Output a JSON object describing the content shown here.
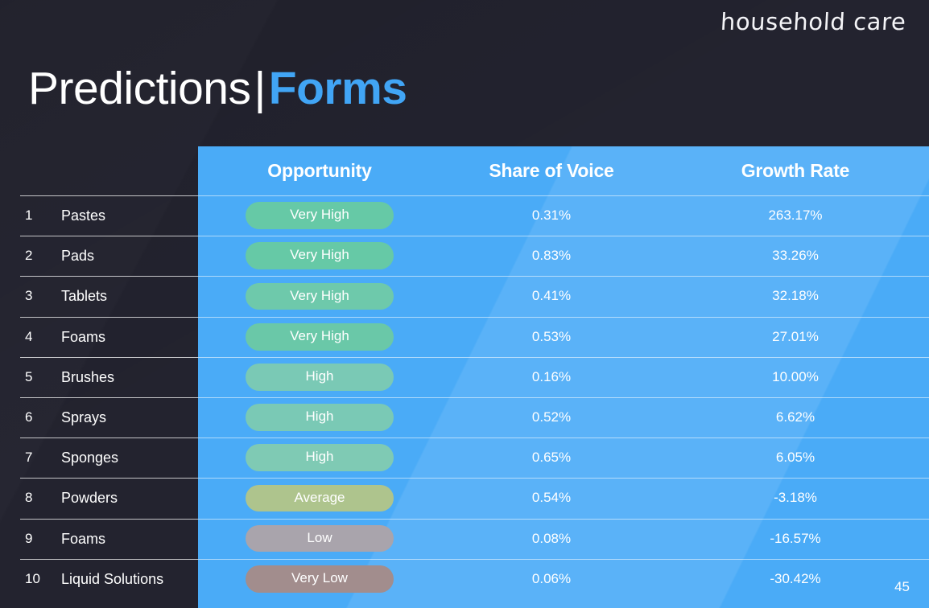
{
  "brand": {
    "text": "household care"
  },
  "title": {
    "main": "Predictions",
    "separator": "|",
    "accent": "Forms"
  },
  "colors": {
    "background": "#23232f",
    "panel_blue": "#4aabf7",
    "title_accent": "#41a5f5",
    "pill_very_high": "#66c9a6",
    "pill_high": "#7ac9b5",
    "pill_average": "#aec48d",
    "pill_low": "#a9a4ac",
    "pill_very_low": "#a28d8d"
  },
  "table": {
    "columns": [
      {
        "key": "rank",
        "label": ""
      },
      {
        "key": "form",
        "label": ""
      },
      {
        "key": "opportunity",
        "label": "Opportunity"
      },
      {
        "key": "share_of_voice",
        "label": "Share of Voice"
      },
      {
        "key": "growth_rate",
        "label": "Growth Rate"
      }
    ],
    "rows": [
      {
        "rank": "1",
        "form": "Pastes",
        "opportunity": "Very High",
        "opportunity_color": "#66c9a6",
        "share_of_voice": "0.31%",
        "growth_rate": "263.17%"
      },
      {
        "rank": "2",
        "form": "Pads",
        "opportunity": "Very High",
        "opportunity_color": "#66c9a6",
        "share_of_voice": "0.83%",
        "growth_rate": "33.26%"
      },
      {
        "rank": "3",
        "form": "Tablets",
        "opportunity": "Very High",
        "opportunity_color": "#6ec9ab",
        "share_of_voice": "0.41%",
        "growth_rate": "32.18%"
      },
      {
        "rank": "4",
        "form": "Foams",
        "opportunity": "Very High",
        "opportunity_color": "#6ac8a8",
        "share_of_voice": "0.53%",
        "growth_rate": "27.01%"
      },
      {
        "rank": "5",
        "form": "Brushes",
        "opportunity": "High",
        "opportunity_color": "#7ac9b5",
        "share_of_voice": "0.16%",
        "growth_rate": "10.00%"
      },
      {
        "rank": "6",
        "form": "Sprays",
        "opportunity": "High",
        "opportunity_color": "#7ac9b5",
        "share_of_voice": "0.52%",
        "growth_rate": "6.62%"
      },
      {
        "rank": "7",
        "form": "Sponges",
        "opportunity": "High",
        "opportunity_color": "#7fcab4",
        "share_of_voice": "0.65%",
        "growth_rate": "6.05%"
      },
      {
        "rank": "8",
        "form": "Powders",
        "opportunity": "Average",
        "opportunity_color": "#aec48d",
        "share_of_voice": "0.54%",
        "growth_rate": "-3.18%"
      },
      {
        "rank": "9",
        "form": "Foams",
        "opportunity": "Low",
        "opportunity_color": "#a9a4ac",
        "share_of_voice": "0.08%",
        "growth_rate": "-16.57%"
      },
      {
        "rank": "10",
        "form": "Liquid Solutions",
        "opportunity": "Very Low",
        "opportunity_color": "#a28d8d",
        "share_of_voice": "0.06%",
        "growth_rate": "-30.42%"
      }
    ]
  },
  "footer": {
    "page_number": "45"
  }
}
